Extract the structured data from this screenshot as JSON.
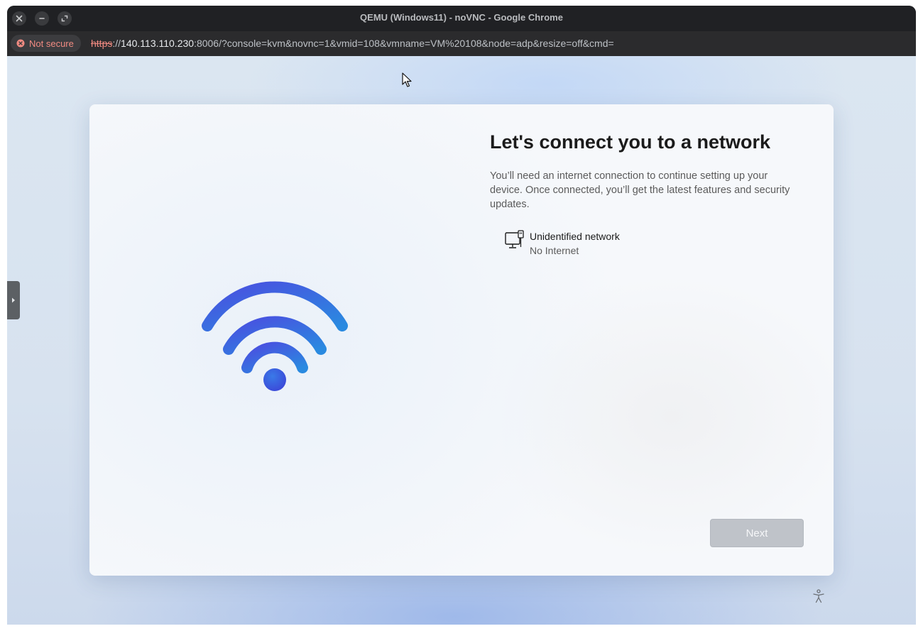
{
  "browser": {
    "window_title": "QEMU (Windows11) - noVNC - Google Chrome",
    "security_label": "Not secure",
    "url_scheme": "https",
    "url_sep": "://",
    "url_host": "140.113.110.230",
    "url_rest": ":8006/?console=kvm&novnc=1&vmid=108&vmname=VM%20108&node=adp&resize=off&cmd="
  },
  "oobe": {
    "title": "Let's connect you to a network",
    "description": "You’ll need an internet connection to continue setting up your device. Once connected, you’ll get the latest features and security updates.",
    "network": {
      "name": "Unidentified network",
      "status": "No Internet"
    },
    "next_label": "Next"
  },
  "colors": {
    "wifi_start": "#4a55e0",
    "wifi_end": "#2a86e0",
    "next_disabled_bg": "#bfc3c9"
  },
  "icons": {
    "close": "close-icon",
    "minimize": "minimize-icon",
    "maximize": "maximize-icon",
    "not_secure": "not-secure-icon",
    "network": "wired-network-icon",
    "wifi": "wifi-icon",
    "accessibility": "accessibility-icon",
    "panel_toggle": "chevron-right-icon"
  }
}
